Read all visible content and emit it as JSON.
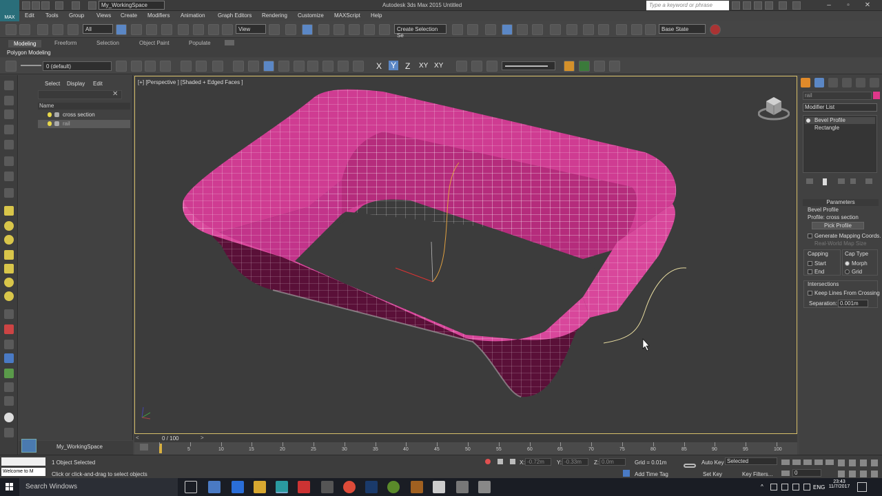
{
  "window": {
    "workspace_select": "My_WorkingSpace",
    "title": "Autodesk 3ds Max 2015     Untitled",
    "search_placeholder": "Type a keyword or phrase",
    "logo": "MAX"
  },
  "menus": [
    "Edit",
    "Tools",
    "Group",
    "Views",
    "Create",
    "Modifiers",
    "Animation",
    "Graph Editors",
    "Rendering",
    "Customize",
    "MAXScript",
    "Help"
  ],
  "main_toolbar": {
    "selection_filter": "All",
    "coord_system": "View",
    "named_selection": "Create Selection Se",
    "state_sets": "Base State"
  },
  "ribbon": {
    "tabs": [
      "Modeling",
      "Freeform",
      "Selection",
      "Object Paint",
      "Populate"
    ],
    "active_tab": "Modeling",
    "subtitle": "Polygon Modeling"
  },
  "toolbar2": {
    "layer": "0 (default)",
    "axes": [
      "X",
      "Y",
      "Z",
      "XY",
      "XY"
    ]
  },
  "scene_explorer": {
    "tabs": [
      "Select",
      "Display",
      "Edit"
    ],
    "column_header": "Name",
    "items": [
      {
        "name": "cross section",
        "selected": false
      },
      {
        "name": "rail",
        "selected": true
      }
    ]
  },
  "viewport": {
    "label": "[+] [Perspective ] [Shaded + Edged Faces ]",
    "mesh_color": "#d13a8f"
  },
  "command_panel": {
    "object_name": "rail",
    "object_color": "#e0378a",
    "modifier_list": "Modifier List",
    "stack": [
      "Bevel Profile",
      "Rectangle"
    ],
    "parameters": {
      "header": "Parameters",
      "group": "Bevel Profile",
      "profile": "Profile: cross section",
      "pick_button": "Pick Profile",
      "gen_mapping": "Generate Mapping Coords.",
      "real_world": "Real-World Map Size",
      "capping_label": "Capping",
      "cap_start": "Start",
      "cap_end": "End",
      "cap_type_label": "Cap Type",
      "morph": "Morph",
      "grid": "Grid",
      "intersections_label": "Intersections",
      "keep_lines": "Keep Lines From Crossing",
      "separation_label": "Separation:",
      "separation_value": "0.001m"
    }
  },
  "timeline": {
    "slider_label": "0 / 100",
    "ticks": [
      "0",
      "5",
      "10",
      "15",
      "20",
      "25",
      "30",
      "35",
      "40",
      "45",
      "50",
      "55",
      "60",
      "65",
      "70",
      "75",
      "80",
      "85",
      "90",
      "95",
      "100"
    ]
  },
  "bottom_left": {
    "workspace": "My_WorkingSpace"
  },
  "status": {
    "welcome": "Welcome to M",
    "selected_count": "1 Object Selected",
    "prompt": "Click or click-and-drag to select objects",
    "x_label": "X:",
    "x_value": "-0.72m",
    "y_label": "Y:",
    "y_value": "-0.33m",
    "z_label": "Z:",
    "z_value": "0.0m",
    "grid": "Grid = 0.01m",
    "add_time_tag": "Add Time Tag",
    "auto_key": "Auto Key",
    "auto_key_select": "Selected",
    "set_key": "Set Key",
    "key_filters": "Key Filters...",
    "frame": "0"
  },
  "taskbar": {
    "search": "Search Windows",
    "lang": "ENG",
    "time": "23:43",
    "date": "11/7/2017"
  }
}
